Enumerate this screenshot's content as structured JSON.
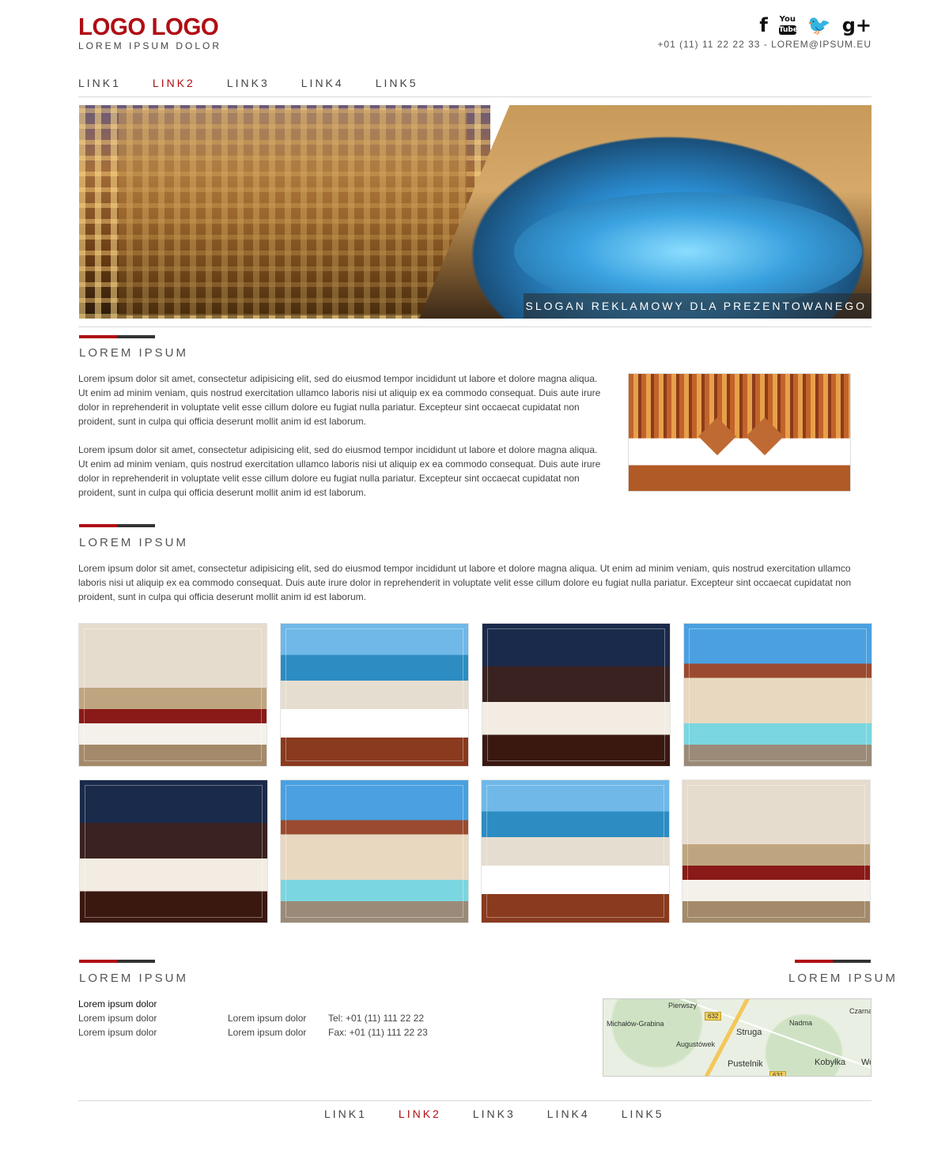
{
  "header": {
    "logo": "LOGO LOGO",
    "tagline": "LOREM IPSUM DOLOR",
    "contact": "+01 (11) 11 22 22 33 - LOREM@IPSUM.EU",
    "social": {
      "facebook": "f",
      "youtube_top": "You",
      "youtube_bottom": "Tube",
      "twitter": "🐦",
      "gplus": "g+"
    }
  },
  "nav": [
    "LINK1",
    "LINK2",
    "LINK3",
    "LINK4",
    "LINK5"
  ],
  "nav_active": "LINK2",
  "hero": {
    "slogan": "SLOGAN REKLAMOWY DLA PREZENTOWANEGO HOTELU"
  },
  "section1": {
    "title": "LOREM IPSUM",
    "paragraphs": [
      "Lorem ipsum dolor sit amet, consectetur adipisicing elit, sed do eiusmod tempor incididunt ut labore et dolore magna aliqua. Ut enim ad minim veniam, quis nostrud exercitation ullamco laboris nisi ut aliquip ex ea commodo consequat. Duis aute irure dolor in reprehenderit in voluptate velit esse cillum dolore eu fugiat nulla pariatur. Excepteur sint occaecat cupidatat non proident, sunt in culpa qui officia deserunt mollit anim id est laborum.",
      "Lorem ipsum dolor sit amet, consectetur adipisicing elit, sed do eiusmod tempor incididunt ut labore et dolore magna aliqua. Ut enim ad minim veniam, quis nostrud exercitation ullamco laboris nisi ut aliquip ex ea commodo consequat. Duis aute irure dolor in reprehenderit in voluptate velit esse cillum dolore eu fugiat nulla pariatur. Excepteur sint occaecat cupidatat non proident, sunt in culpa qui officia deserunt mollit anim id est laborum."
    ]
  },
  "section2": {
    "title": "LOREM IPSUM",
    "paragraph": "Lorem ipsum dolor sit amet, consectetur adipisicing elit, sed do eiusmod tempor incididunt ut labore et dolore magna aliqua. Ut enim ad minim veniam, quis nostrud exercitation ullamco laboris nisi ut aliquip ex ea commodo consequat. Duis aute irure dolor in reprehenderit in voluptate velit esse cillum dolore eu fugiat nulla pariatur. Excepteur sint occaecat cupidatat non proident, sunt in culpa qui officia deserunt mollit anim id est laborum."
  },
  "footer": {
    "left_title": "LOREM IPSUM",
    "right_title": "LOREM IPSUM",
    "col1": [
      "Lorem ipsum dolor",
      "Lorem ipsum dolor",
      "Lorem ipsum dolor"
    ],
    "col2": [
      "Lorem ipsum dolor",
      "Lorem ipsum dolor"
    ],
    "col3": [
      "Tel: +01 (11) 111 22 22",
      "Fax: +01 (11) 111 22 23"
    ],
    "map_labels": {
      "pierwszy": "Pierwszy",
      "michalow": "Michałów-Grabina",
      "augustowek": "Augustówek",
      "struga": "Struga",
      "nadma": "Nadma",
      "pustelnik": "Pustelnik",
      "kobylka": "Kobyłka",
      "czarna": "Czarna",
      "wo": "Wo",
      "road632": "632",
      "road631": "631"
    }
  },
  "footer_nav": [
    "LINK1",
    "LINK2",
    "LINK3",
    "LINK4",
    "LINK5"
  ]
}
